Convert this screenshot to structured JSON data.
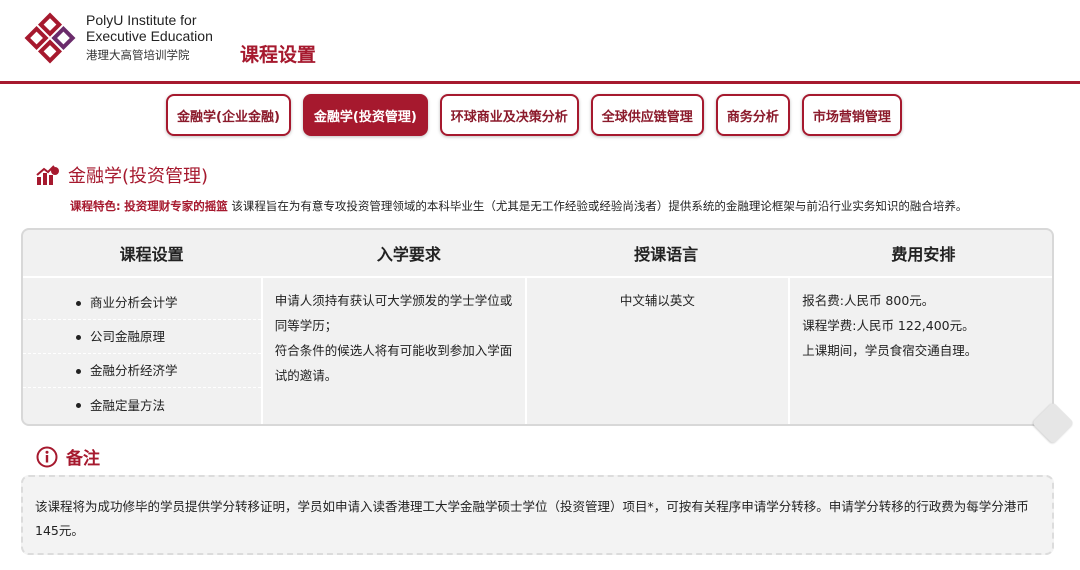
{
  "header": {
    "institute_line1": "PolyU Institute for",
    "institute_line2": "Executive Education",
    "institute_zh": "港理大高管培训学院",
    "page_title": "课程设置"
  },
  "tabs": [
    {
      "label": "金融学(企业金融)",
      "active": false
    },
    {
      "label": "金融学(投资管理)",
      "active": true
    },
    {
      "label": "环球商业及决策分析",
      "active": false
    },
    {
      "label": "全球供应链管理",
      "active": false
    },
    {
      "label": "商务分析",
      "active": false
    },
    {
      "label": "市场营销管理",
      "active": false
    }
  ],
  "program": {
    "title": "金融学(投资管理)",
    "feature_label": "课程特色:",
    "feature_highlight": "投资理财专家的摇篮",
    "feature_text": "该课程旨在为有意专攻投资管理领域的本科毕业生（尤其是无工作经验或经验尚浅者）提供系统的金融理论框架与前沿行业实务知识的融合培养。"
  },
  "table": {
    "headers": [
      "课程设置",
      "入学要求",
      "授课语言",
      "费用安排"
    ],
    "courses": [
      "商业分析会计学",
      "公司金融原理",
      "金融分析经济学",
      "金融定量方法"
    ],
    "requirements": [
      "申请人须持有获认可大学颁发的学士学位或同等学历；",
      "符合条件的候选人将有可能收到参加入学面试的邀请。"
    ],
    "language": "中文辅以英文",
    "fees": [
      "报名费:人民币 800元。",
      "课程学费:人民币 122,400元。",
      "上课期间，学员食宿交通自理。"
    ]
  },
  "remarks": {
    "title": "备注",
    "text": "该课程将为成功修毕的学员提供学分转移证明，学员如申请入读香港理工大学金融学硕士学位（投资管理）项目*，可按有关程序申请学分转移。申请学分转移的行政费为每学分港币145元。"
  },
  "colors": {
    "brand": "#a6192e",
    "logo_purple": "#6b2c6b"
  }
}
